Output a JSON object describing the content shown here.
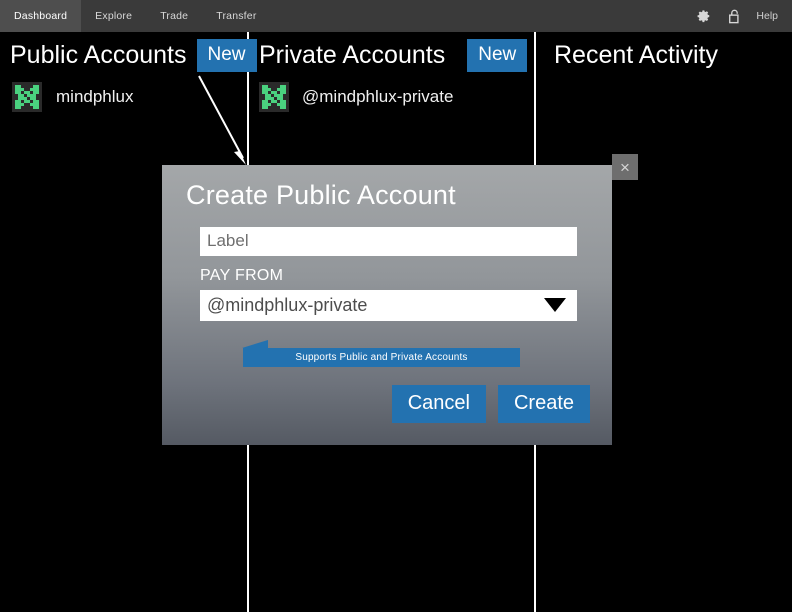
{
  "topbar": {
    "tabs": [
      {
        "label": "Dashboard",
        "active": true
      },
      {
        "label": "Explore",
        "active": false
      },
      {
        "label": "Trade",
        "active": false
      },
      {
        "label": "Transfer",
        "active": false
      }
    ],
    "settings_icon": "gear-icon",
    "lock_icon": "unlocked-padlock-icon",
    "help_label": "Help"
  },
  "columns": {
    "public": {
      "title": "Public Accounts",
      "new_button_label": "New",
      "accounts": [
        {
          "name": "mindphlux",
          "avatar": "identicon-green"
        }
      ]
    },
    "private": {
      "title": "Private Accounts",
      "new_button_label": "New",
      "accounts": [
        {
          "name": "@mindphlux-private",
          "avatar": "identicon-green"
        }
      ]
    },
    "recent": {
      "title": "Recent Activity",
      "items": []
    }
  },
  "modal": {
    "title": "Create Public Account",
    "close_label": "×",
    "label_field": {
      "placeholder": "Label",
      "value": ""
    },
    "pay_from": {
      "label": "PAY FROM",
      "selected": "@mindphlux-private",
      "options": [
        "@mindphlux-private"
      ]
    },
    "callout": {
      "text": "Supports Public and Private Accounts"
    },
    "cancel_label": "Cancel",
    "create_label": "Create"
  },
  "colors": {
    "accent_blue": "#2372b0",
    "topbar_bg": "#3a3a3a",
    "active_tab_bg": "#4e4e4e",
    "page_bg": "#000000",
    "divider": "#ffffff",
    "avatar_green": "#4ad17f",
    "modal_top": "#a4a7a9",
    "modal_bottom": "#555a63"
  }
}
